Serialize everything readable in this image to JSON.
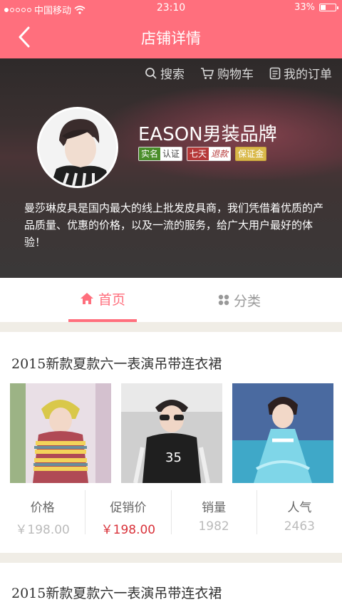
{
  "status_bar": {
    "carrier": "中国移动",
    "time": "23:10",
    "battery": "33%",
    "battery_level": 0.33
  },
  "nav": {
    "title": "店铺详情",
    "back_icon": "chevron-left-icon"
  },
  "toolbar": {
    "search": "搜索",
    "cart": "购物车",
    "orders": "我的订单"
  },
  "shop": {
    "name": "EASON男装品牌",
    "badges": [
      {
        "a": "实名",
        "b": "认证"
      },
      {
        "a": "七天",
        "b": "退款"
      },
      {
        "a": "保证金"
      }
    ],
    "description": "曼莎琳皮具是国内最大的线上批发皮具商，我们凭借着优质的产品质量、优惠的价格，以及一流的服务，给广大用户最好的体验！"
  },
  "tabs": [
    {
      "label": "首页",
      "active": true
    },
    {
      "label": "分类",
      "active": false
    }
  ],
  "products": [
    {
      "title": "2015新款夏款六一表演吊带连衣裙",
      "stats": [
        {
          "label": "价格",
          "value": "￥198.00"
        },
        {
          "label": "促销价",
          "value": "￥198.00"
        },
        {
          "label": "销量",
          "value": "1982"
        },
        {
          "label": "人气",
          "value": "2463"
        }
      ]
    },
    {
      "title": "2015新款夏款六一表演吊带连衣裙"
    }
  ],
  "colors": {
    "brand": "#ff6f7d",
    "price_red": "#d9323a"
  }
}
